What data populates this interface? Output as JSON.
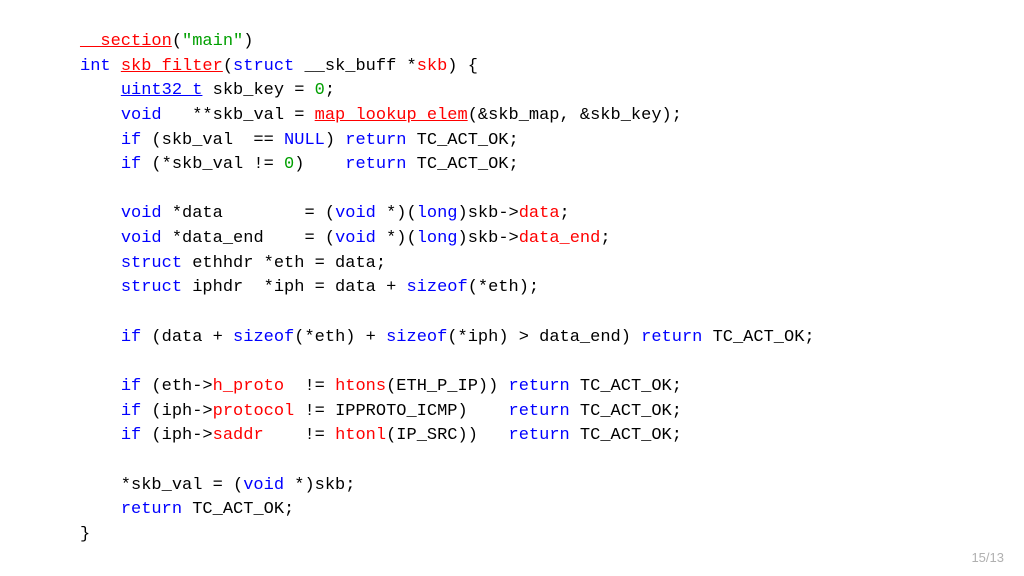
{
  "page_number": "15/13",
  "code": {
    "lines": [
      [
        {
          "t": "__section",
          "c": "func",
          "u": true
        },
        {
          "t": "(",
          "c": "paren"
        },
        {
          "t": "\"main\"",
          "c": "string"
        },
        {
          "t": ")",
          "c": "paren"
        }
      ],
      [
        {
          "t": "int",
          "c": "type"
        },
        {
          "t": " ",
          "c": "ident"
        },
        {
          "t": "skb_filter",
          "c": "func",
          "u": true
        },
        {
          "t": "(",
          "c": "paren"
        },
        {
          "t": "struct",
          "c": "keyword"
        },
        {
          "t": " __sk_buff *",
          "c": "ident"
        },
        {
          "t": "skb",
          "c": "func"
        },
        {
          "t": ") {",
          "c": "paren"
        }
      ],
      [
        {
          "t": "    ",
          "c": "ident"
        },
        {
          "t": "uint32_t",
          "c": "type",
          "u": true
        },
        {
          "t": " skb_key = ",
          "c": "ident"
        },
        {
          "t": "0",
          "c": "num"
        },
        {
          "t": ";",
          "c": "paren"
        }
      ],
      [
        {
          "t": "    ",
          "c": "ident"
        },
        {
          "t": "void",
          "c": "type"
        },
        {
          "t": "   **skb_val = ",
          "c": "ident"
        },
        {
          "t": "map_lookup_elem",
          "c": "func",
          "u": true
        },
        {
          "t": "(&skb_map, &skb_key);",
          "c": "paren"
        }
      ],
      [
        {
          "t": "    ",
          "c": "ident"
        },
        {
          "t": "if",
          "c": "keyword"
        },
        {
          "t": " (skb_val  == ",
          "c": "ident"
        },
        {
          "t": "NULL",
          "c": "null"
        },
        {
          "t": ") ",
          "c": "paren"
        },
        {
          "t": "return",
          "c": "keyword"
        },
        {
          "t": " TC_ACT_OK;",
          "c": "ident"
        }
      ],
      [
        {
          "t": "    ",
          "c": "ident"
        },
        {
          "t": "if",
          "c": "keyword"
        },
        {
          "t": " (*skb_val != ",
          "c": "ident"
        },
        {
          "t": "0",
          "c": "num"
        },
        {
          "t": ")    ",
          "c": "paren"
        },
        {
          "t": "return",
          "c": "keyword"
        },
        {
          "t": " TC_ACT_OK;",
          "c": "ident"
        }
      ],
      [
        {
          "t": " ",
          "c": "ident"
        }
      ],
      [
        {
          "t": "    ",
          "c": "ident"
        },
        {
          "t": "void",
          "c": "type"
        },
        {
          "t": " *data        = (",
          "c": "ident"
        },
        {
          "t": "void",
          "c": "type"
        },
        {
          "t": " *)(",
          "c": "ident"
        },
        {
          "t": "long",
          "c": "type"
        },
        {
          "t": ")skb",
          "c": "ident"
        },
        {
          "t": "->",
          "c": "arrow"
        },
        {
          "t": "data",
          "c": "member"
        },
        {
          "t": ";",
          "c": "paren"
        }
      ],
      [
        {
          "t": "    ",
          "c": "ident"
        },
        {
          "t": "void",
          "c": "type"
        },
        {
          "t": " *data_end    = (",
          "c": "ident"
        },
        {
          "t": "void",
          "c": "type"
        },
        {
          "t": " *)(",
          "c": "ident"
        },
        {
          "t": "long",
          "c": "type"
        },
        {
          "t": ")skb",
          "c": "ident"
        },
        {
          "t": "->",
          "c": "arrow"
        },
        {
          "t": "data_end",
          "c": "member"
        },
        {
          "t": ";",
          "c": "paren"
        }
      ],
      [
        {
          "t": "    ",
          "c": "ident"
        },
        {
          "t": "struct",
          "c": "keyword"
        },
        {
          "t": " ethhdr *eth = data;",
          "c": "ident"
        }
      ],
      [
        {
          "t": "    ",
          "c": "ident"
        },
        {
          "t": "struct",
          "c": "keyword"
        },
        {
          "t": " iphdr  *iph = data + ",
          "c": "ident"
        },
        {
          "t": "sizeof",
          "c": "keyword"
        },
        {
          "t": "(*eth);",
          "c": "paren"
        }
      ],
      [
        {
          "t": " ",
          "c": "ident"
        }
      ],
      [
        {
          "t": "    ",
          "c": "ident"
        },
        {
          "t": "if",
          "c": "keyword"
        },
        {
          "t": " (data + ",
          "c": "ident"
        },
        {
          "t": "sizeof",
          "c": "keyword"
        },
        {
          "t": "(*eth) + ",
          "c": "ident"
        },
        {
          "t": "sizeof",
          "c": "keyword"
        },
        {
          "t": "(*iph) > data_end) ",
          "c": "ident"
        },
        {
          "t": "return",
          "c": "keyword"
        },
        {
          "t": " TC_ACT_OK;",
          "c": "ident"
        }
      ],
      [
        {
          "t": " ",
          "c": "ident"
        }
      ],
      [
        {
          "t": "    ",
          "c": "ident"
        },
        {
          "t": "if",
          "c": "keyword"
        },
        {
          "t": " (eth",
          "c": "ident"
        },
        {
          "t": "->",
          "c": "arrow"
        },
        {
          "t": "h_proto",
          "c": "member"
        },
        {
          "t": "  != ",
          "c": "ident"
        },
        {
          "t": "htons",
          "c": "func"
        },
        {
          "t": "(ETH_P_IP)) ",
          "c": "paren"
        },
        {
          "t": "return",
          "c": "keyword"
        },
        {
          "t": " TC_ACT_OK;",
          "c": "ident"
        }
      ],
      [
        {
          "t": "    ",
          "c": "ident"
        },
        {
          "t": "if",
          "c": "keyword"
        },
        {
          "t": " (iph",
          "c": "ident"
        },
        {
          "t": "->",
          "c": "arrow"
        },
        {
          "t": "protocol",
          "c": "member"
        },
        {
          "t": " != IPPROTO_ICMP)    ",
          "c": "ident"
        },
        {
          "t": "return",
          "c": "keyword"
        },
        {
          "t": " TC_ACT_OK;",
          "c": "ident"
        }
      ],
      [
        {
          "t": "    ",
          "c": "ident"
        },
        {
          "t": "if",
          "c": "keyword"
        },
        {
          "t": " (iph",
          "c": "ident"
        },
        {
          "t": "->",
          "c": "arrow"
        },
        {
          "t": "saddr",
          "c": "member"
        },
        {
          "t": "    != ",
          "c": "ident"
        },
        {
          "t": "htonl",
          "c": "func"
        },
        {
          "t": "(IP_SRC))   ",
          "c": "paren"
        },
        {
          "t": "return",
          "c": "keyword"
        },
        {
          "t": " TC_ACT_OK;",
          "c": "ident"
        }
      ],
      [
        {
          "t": " ",
          "c": "ident"
        }
      ],
      [
        {
          "t": "    *skb_val = (",
          "c": "ident"
        },
        {
          "t": "void",
          "c": "type"
        },
        {
          "t": " *)skb;",
          "c": "ident"
        }
      ],
      [
        {
          "t": "    ",
          "c": "ident"
        },
        {
          "t": "return",
          "c": "keyword"
        },
        {
          "t": " TC_ACT_OK;",
          "c": "ident"
        }
      ],
      [
        {
          "t": "}",
          "c": "paren"
        }
      ]
    ]
  }
}
